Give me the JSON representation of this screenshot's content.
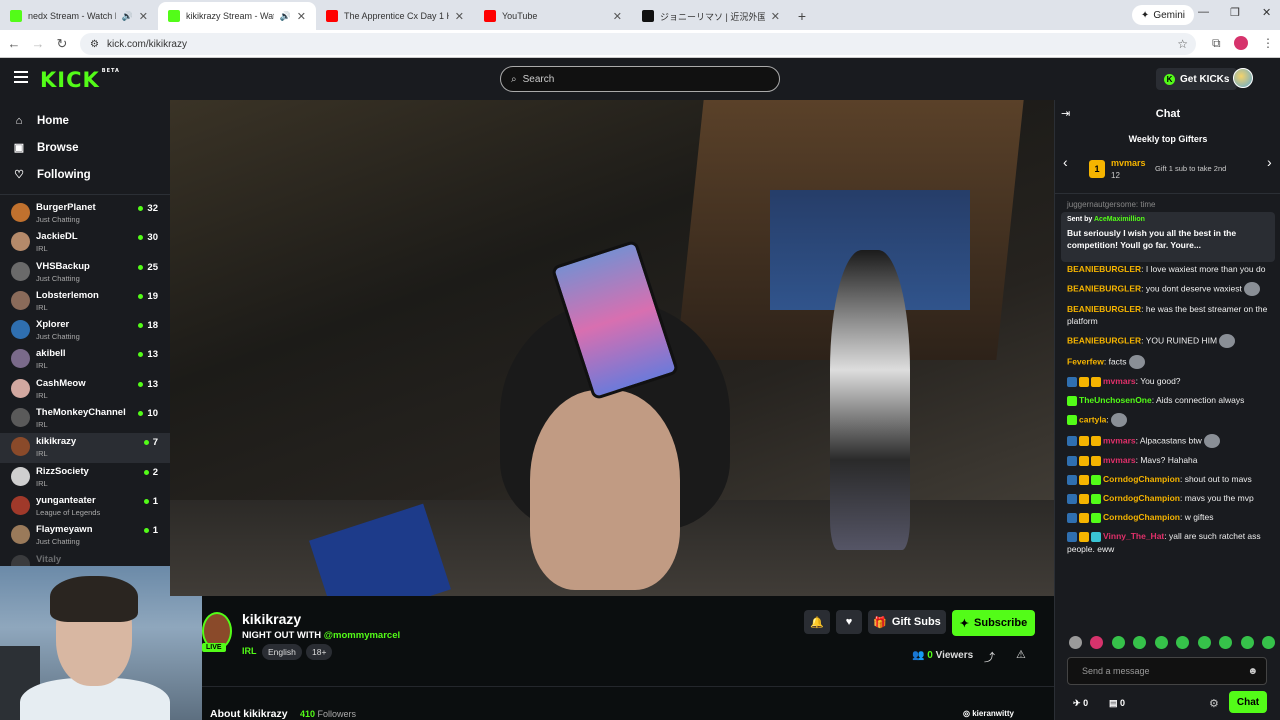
{
  "browser": {
    "tabs": [
      {
        "title": "nedx Stream - Watch Live o",
        "favicon_color": "#53fc18",
        "audio": true
      },
      {
        "title": "kikikrazy Stream - Watch Li",
        "favicon_color": "#53fc18",
        "audio": true,
        "active": true
      },
      {
        "title": "The Apprentice Cx Day 1 Highli",
        "favicon_color": "#ff0000"
      },
      {
        "title": "YouTube",
        "favicon_color": "#ff0000"
      },
      {
        "title": "ジョニーリマソ | 近況外国人接触",
        "favicon_color": "#111111"
      }
    ],
    "gemini_label": "Gemini",
    "url": "kick.com/kikikrazy"
  },
  "kick": {
    "logo_text": "KICK",
    "logo_sup": "BETA",
    "search_placeholder": "Search",
    "get_kicks": "Get KICKs",
    "accent": "#53fc18"
  },
  "sidebar": {
    "nav": [
      {
        "label": "Home",
        "icon": "home-icon"
      },
      {
        "label": "Browse",
        "icon": "browse-icon"
      },
      {
        "label": "Following",
        "icon": "heart-icon"
      }
    ],
    "channels": [
      {
        "name": "BurgerPlanet",
        "category": "Just Chatting",
        "viewers": "32",
        "color": "#c0712e"
      },
      {
        "name": "JackieDL",
        "category": "IRL",
        "viewers": "30",
        "color": "#b58a6a"
      },
      {
        "name": "VHSBackup",
        "category": "Just Chatting",
        "viewers": "25",
        "color": "#6a6a6a"
      },
      {
        "name": "Lobsterlemon",
        "category": "IRL",
        "viewers": "19",
        "color": "#8a6b5a"
      },
      {
        "name": "Xplorer",
        "category": "Just Chatting",
        "viewers": "18",
        "color": "#2f6fb0"
      },
      {
        "name": "akibell",
        "category": "IRL",
        "viewers": "13",
        "color": "#7a6a8a"
      },
      {
        "name": "CashMeow",
        "category": "IRL",
        "viewers": "13",
        "color": "#d2a8a0"
      },
      {
        "name": "TheMonkeyChannel",
        "category": "IRL",
        "viewers": "10",
        "color": "#5a5a5a"
      },
      {
        "name": "kikikrazy",
        "category": "IRL",
        "viewers": "7",
        "color": "#8a4a2a",
        "selected": true
      },
      {
        "name": "RizzSociety",
        "category": "IRL",
        "viewers": "2",
        "color": "#cfcfcf"
      },
      {
        "name": "yunganteater",
        "category": "League of Legends",
        "viewers": "1",
        "color": "#a0392a"
      },
      {
        "name": "Flaymeyawn",
        "category": "Just Chatting",
        "viewers": "1",
        "color": "#9a7a5a"
      },
      {
        "name": "Vitaly",
        "category": "",
        "viewers": "",
        "color": "#777777",
        "faded": true
      }
    ]
  },
  "stream": {
    "channel_name": "kikikrazy",
    "live_label": "LIVE",
    "title_prefix": "NIGHT OUT WITH ",
    "title_mention": "@mommymarcel",
    "category": "IRL",
    "tags": [
      "English",
      "18+"
    ],
    "gift_subs": "Gift Subs",
    "subscribe": "Subscribe",
    "viewers_count": "0",
    "viewers_label": "Viewers",
    "about": "About kikikrazy",
    "followers_count": "410",
    "followers_label": "Followers",
    "instagram": "kieranwitty"
  },
  "chat": {
    "header": "Chat",
    "gifters_title": "Weekly top Gifters",
    "top_gifter": {
      "rank": "1",
      "name": "mvmars",
      "count": "12"
    },
    "gifter_cta": "Gift 1 sub to take 2nd",
    "partial_line": "juggernautgersome: time",
    "pinned": {
      "sent_by_prefix": "Sent by ",
      "sent_by_user": "AceMaximillion",
      "text": "But seriously I wish you all the best in the competition! Youll go far. Youre..."
    },
    "messages": [
      {
        "user": "BEANIEBURGLER",
        "color": "#f5b400",
        "text": "I love waxiest more than you do",
        "badges": []
      },
      {
        "user": "BEANIEBURGLER",
        "color": "#f5b400",
        "text": "you dont deserve waxiest",
        "badges": [],
        "emote": true
      },
      {
        "user": "BEANIEBURGLER",
        "color": "#f5b400",
        "text": "he was the best streamer on the platform",
        "badges": []
      },
      {
        "user": "BEANIEBURGLER",
        "color": "#f5b400",
        "text": "YOU RUINED HIM",
        "badges": [],
        "emote": true
      },
      {
        "user": "Feverfew",
        "color": "#f5b400",
        "text": "facts",
        "badges": [],
        "emote": true
      },
      {
        "user": "mvmars",
        "color": "#e0306a",
        "text": "You good?",
        "badges": [
          "#2f6fb0",
          "#f5b400",
          "#f5b400"
        ]
      },
      {
        "user": "TheUnchosenOne",
        "color": "#53fc18",
        "text": "Aids connection always",
        "badges": [
          "#53fc18"
        ]
      },
      {
        "user": "cartyla",
        "color": "#f5b400",
        "text": "",
        "badges": [
          "#53fc18"
        ],
        "emote": true
      },
      {
        "user": "mvmars",
        "color": "#e0306a",
        "text": "Alpacastans btw",
        "badges": [
          "#2f6fb0",
          "#f5b400",
          "#f5b400"
        ],
        "emote": true
      },
      {
        "user": "mvmars",
        "color": "#e0306a",
        "text": "Mavs? Hahaha",
        "badges": [
          "#2f6fb0",
          "#f5b400",
          "#f5b400"
        ]
      },
      {
        "user": "CorndogChampion",
        "color": "#f5b400",
        "text": "shout out to mavs",
        "badges": [
          "#2f6fb0",
          "#f5b400",
          "#53fc18"
        ]
      },
      {
        "user": "CorndogChampion",
        "color": "#f5b400",
        "text": "mavs you the mvp",
        "badges": [
          "#2f6fb0",
          "#f5b400",
          "#53fc18"
        ]
      },
      {
        "user": "CorndogChampion",
        "color": "#f5b400",
        "text": "w giftes",
        "badges": [
          "#2f6fb0",
          "#f5b400",
          "#53fc18"
        ]
      },
      {
        "user": "Vinny_The_Hat",
        "color": "#e0306a",
        "text": "yall are such ratchet ass people. eww",
        "badges": [
          "#2f6fb0",
          "#f5b400",
          "#3ac4d4"
        ]
      }
    ],
    "input_placeholder": "Send a message",
    "kick_count": "0",
    "trash_count": "0",
    "send_label": "Chat"
  }
}
